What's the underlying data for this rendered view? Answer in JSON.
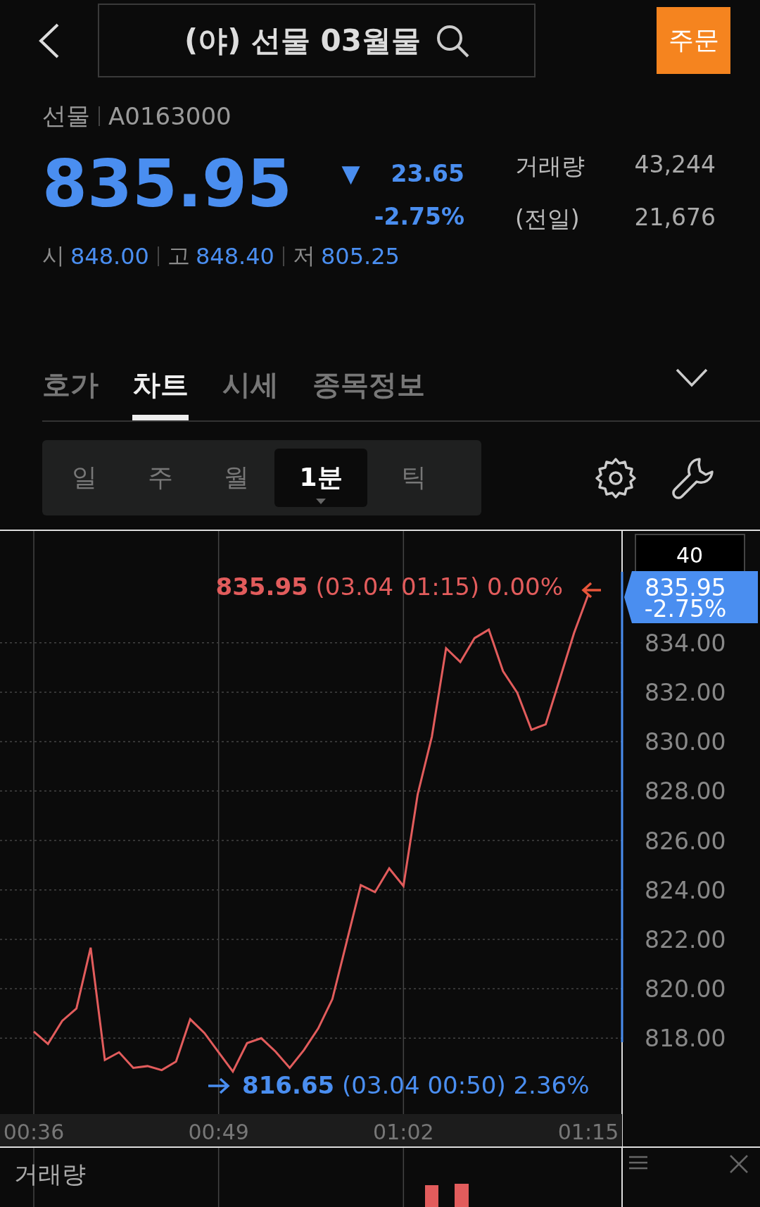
{
  "header": {
    "title": "(야) 선물 03월물",
    "order_button": "주문"
  },
  "quote": {
    "category": "선물",
    "code": "A0163000",
    "price": "835.95",
    "change_symbol": "▼",
    "change": "23.65",
    "change_rate": "-2.75%",
    "volume_label": "거래량",
    "volume": "43,244",
    "prev_label": "(전일)",
    "prev_volume": "21,676",
    "ohlc": [
      {
        "label": "시",
        "value": "848.00"
      },
      {
        "label": "고",
        "value": "848.40"
      },
      {
        "label": "저",
        "value": "805.25"
      }
    ]
  },
  "tabs": [
    {
      "label": "호가",
      "selected": false
    },
    {
      "label": "차트",
      "selected": true
    },
    {
      "label": "시세",
      "selected": false
    },
    {
      "label": "종목정보",
      "selected": false
    }
  ],
  "periods": [
    {
      "label": "일",
      "selected": false
    },
    {
      "label": "주",
      "selected": false
    },
    {
      "label": "월",
      "selected": false
    },
    {
      "label": "1분",
      "selected": true
    },
    {
      "label": "틱",
      "selected": false
    }
  ],
  "chart": {
    "count": "40",
    "price_tag": {
      "price": "835.95",
      "rate": "-2.75%"
    },
    "high": {
      "price": "835.95",
      "detail": "(03.04 01:15) 0.00%"
    },
    "low": {
      "price": "816.65",
      "detail": "(03.04 00:50) 2.36%"
    },
    "chart_data": {
      "type": "line",
      "series": [
        {
          "color": "#e25c5c",
          "values": [
            818.27,
            817.77,
            818.7,
            819.2,
            821.66,
            817.12,
            817.43,
            816.8,
            816.87,
            816.71,
            817.05,
            818.77,
            818.21,
            817.43,
            816.65,
            817.8,
            818.0,
            817.46,
            816.8,
            817.52,
            818.39,
            819.58,
            821.88,
            824.19,
            823.91,
            824.87,
            824.16,
            827.86,
            830.2,
            833.78,
            833.22,
            834.19,
            834.53,
            832.85,
            831.98,
            830.48,
            830.7,
            832.54,
            834.4,
            835.95
          ]
        }
      ],
      "categories": [
        "00:36",
        null,
        null,
        null,
        null,
        null,
        null,
        null,
        null,
        null,
        null,
        null,
        null,
        "00:49",
        null,
        null,
        null,
        null,
        null,
        null,
        null,
        null,
        null,
        null,
        null,
        null,
        "01:02",
        null,
        null,
        null,
        null,
        null,
        null,
        null,
        null,
        null,
        null,
        null,
        null,
        "01:15"
      ],
      "ylim": [
        813.62,
        838.58
      ],
      "grid": true,
      "yticks": [
        {
          "value": 834,
          "label": "834.00"
        },
        {
          "value": 832,
          "label": "832.00"
        },
        {
          "value": 830,
          "label": "830.00"
        },
        {
          "value": 828,
          "label": "828.00"
        },
        {
          "value": 826,
          "label": "826.00"
        },
        {
          "value": 824,
          "label": "824.00"
        },
        {
          "value": 822,
          "label": "822.00"
        },
        {
          "value": 820,
          "label": "820.00"
        },
        {
          "value": 818,
          "label": "818.00"
        }
      ]
    }
  },
  "volume_panel": {
    "title": "거래량"
  }
}
